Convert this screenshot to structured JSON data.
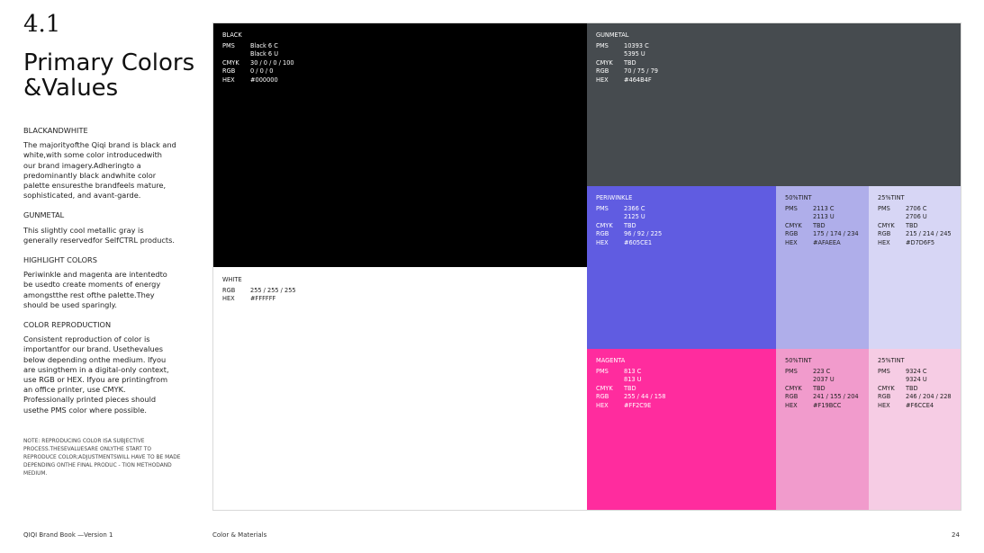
{
  "section_number": "4.1",
  "title_line1": "Primary Colors",
  "title_line2": "&Values",
  "left": {
    "bw_heading": "BLACKANDWHITE",
    "bw_text": "The majorityofthe Qiqi brand is black and white,with some color introducedwith our brand imagery.Adheringto a predominantly black andwhite color palette ensuresthe brandfeels mature, sophisticated, and avant-garde.",
    "gunmetal_heading": "GUNMETAL",
    "gunmetal_text": "This slightly cool metallic gray is generally reservedfor SelfCTRL products.",
    "highlight_heading": "HIGHLIGHT COLORS",
    "highlight_text": "Periwinkle and magenta are intentedto be usedto create moments of energy amongstthe rest ofthe palette.They should be used sparingly.",
    "repro_heading": "COLOR REPRODUCTION",
    "repro_text": "Consistent reproduction of color is importantfor our brand. Usethevalues below depending onthe medium. Ifyou are usingthem in a digital-only context, use RGB or HEX. Ifyou are printingfrom an office printer, use CMYK. Professionally printed pieces should usethe PMS color where possible.",
    "note": "NOTE: REPRODUCING COLOR ISA SUBJECTIVE PROCESS.THESEVALUESARE ONLYTHE START TO REPRODUCE COLOR;ADJUSTMENTSWILL HAVE TO BE MADE DEPENDING ONTHE FINAL PRODUC - TION METHODAND MEDIUM."
  },
  "labels": {
    "pms": "PMS",
    "cmyk": "CMYK",
    "rgb": "RGB",
    "hex": "HEX"
  },
  "swatches": {
    "black": {
      "name": "BLACK",
      "pms": "Black 6 C\nBlack 6 U",
      "cmyk": "30 / 0 / 0 / 100",
      "rgb": "0 / 0 / 0",
      "hex": "#000000",
      "color": "#000000"
    },
    "white": {
      "name": "WHITE",
      "rgb": "255 / 255 / 255",
      "hex": "#FFFFFF",
      "color": "#FFFFFF"
    },
    "gunmetal": {
      "name": "GUNMETAL",
      "pms": "10393 C\n5395 U",
      "cmyk": "TBD",
      "rgb": "70 / 75 / 79",
      "hex": "#464B4F",
      "color": "#464B4F"
    },
    "periwinkle": {
      "name": "PERIWINKLE",
      "pms": "2366 C\n2125 U",
      "cmyk": "TBD",
      "rgb": "96 / 92 / 225",
      "hex": "#605CE1",
      "color": "#605CE1"
    },
    "peri50": {
      "name": "50%TINT",
      "pms": "2113 C\n2113 U",
      "cmyk": "TBD",
      "rgb": "175 / 174 / 234",
      "hex": "#AFAEEA",
      "color": "#AFAEEA"
    },
    "peri25": {
      "name": "25%TINT",
      "pms": "2706 C\n2706 U",
      "cmyk": "TBD",
      "rgb": "215 / 214 / 245",
      "hex": "#D7D6F5",
      "color": "#D7D6F5"
    },
    "magenta": {
      "name": "MAGENTA",
      "pms": "813 C\n813 U",
      "cmyk": "TBD",
      "rgb": "255 / 44 / 158",
      "hex": "#FF2C9E",
      "color": "#FF2C9E"
    },
    "mag50": {
      "name": "50%TINT",
      "pms": "223 C\n2037 U",
      "cmyk": "TBD",
      "rgb": "241 / 155 / 204",
      "hex": "#F19BCC",
      "color": "#F19BCC"
    },
    "mag25": {
      "name": "25%TINT",
      "pms": "9324 C\n9324 U",
      "cmyk": "TBD",
      "rgb": "246 / 204 / 228",
      "hex": "#F6CCE4",
      "color": "#F6CCE4"
    }
  },
  "footer": {
    "left": "QIQI Brand Book —Version 1",
    "center": "Color & Materials",
    "page": "24"
  }
}
